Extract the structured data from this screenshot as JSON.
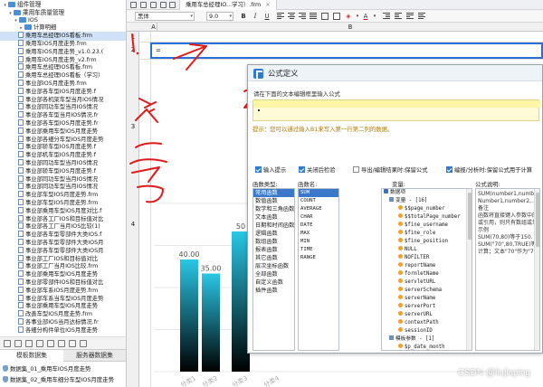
{
  "tree": {
    "items": [
      {
        "level": 0,
        "kind": "folder",
        "label": "组件管理",
        "expand": "▾"
      },
      {
        "level": 1,
        "kind": "folder",
        "label": "乘用车质量管理",
        "expand": "▾"
      },
      {
        "level": 2,
        "kind": "folder",
        "label": "IOS",
        "expand": "▾"
      },
      {
        "level": 3,
        "kind": "folder",
        "label": "计算明细",
        "expand": "▸"
      },
      {
        "level": 3,
        "kind": "file",
        "label": "乘用车总经理IOS看板.frm",
        "selected": true
      },
      {
        "level": 3,
        "kind": "file",
        "label": "乘用车IOS月度走势.frm"
      },
      {
        "level": 3,
        "kind": "file",
        "label": "乘用车IOS月度走势_v1.0.23.("
      },
      {
        "level": 3,
        "kind": "file",
        "label": "乘用车IOS月度走势_v2.frm"
      },
      {
        "level": 3,
        "kind": "file",
        "label": "乘用车总经理IOS看板.frm"
      },
      {
        "level": 3,
        "kind": "file",
        "label": "乘用车总经理IOS看板（学习）"
      },
      {
        "level": 3,
        "kind": "file",
        "label": "事业部IOS月度走势.frm"
      },
      {
        "level": 3,
        "kind": "file",
        "label": "事业部各车型IOS月度走势.f"
      },
      {
        "level": 3,
        "kind": "file",
        "label": "事业部各机架车型当月IOS情况"
      },
      {
        "level": 3,
        "kind": "file",
        "label": "事业部同功车型当月IOS情况"
      },
      {
        "level": 3,
        "kind": "file",
        "label": "事业部各车型当月IOS情况.fr"
      },
      {
        "level": 3,
        "kind": "file",
        "label": "事业部各车型IOS月度走势.fr"
      },
      {
        "level": 3,
        "kind": "file",
        "label": "事业部乘用车型IOS月度走势"
      },
      {
        "level": 3,
        "kind": "file",
        "label": "事业部各细分车型IOS月度走势"
      },
      {
        "level": 3,
        "kind": "file",
        "label": "事业部轿车型IOS月度走势.f"
      },
      {
        "level": 3,
        "kind": "file",
        "label": "事业部机车型IOS月度走势.f"
      },
      {
        "level": 3,
        "kind": "file",
        "label": "事业部同功车型当月IOS情况"
      },
      {
        "level": 3,
        "kind": "file",
        "label": "事业部轿车型IOS月度走势.f"
      },
      {
        "level": 3,
        "kind": "file",
        "label": "事业部同功车型当月IOS情况"
      },
      {
        "level": 3,
        "kind": "file",
        "label": "事业部同功车型当月IOS情况"
      },
      {
        "level": 3,
        "kind": "file",
        "label": "事业部车型IOS月度走势.frm"
      },
      {
        "level": 3,
        "kind": "file",
        "label": "事业部车型IOS月度走势.frm"
      },
      {
        "level": 3,
        "kind": "file",
        "label": "事业部乘用车型IOS月度对比.f"
      },
      {
        "level": 3,
        "kind": "file",
        "label": "事业部各工厂IOS和目标值对比"
      },
      {
        "level": 3,
        "kind": "file",
        "label": "事业部各工厂当月IOS比较(1)"
      },
      {
        "level": 3,
        "kind": "file",
        "label": "事业部各车型零部件大类IOS.f"
      },
      {
        "level": 3,
        "kind": "file",
        "label": "事业部各车型零部件大类IOS月"
      },
      {
        "level": 3,
        "kind": "file",
        "label": "事业部各车型零部件大类IOS月"
      },
      {
        "level": 3,
        "kind": "file",
        "label": "事业部工厂IOS和目标值对比"
      },
      {
        "level": 3,
        "kind": "file",
        "label": "事业部工厂当月IOS比较.frm"
      },
      {
        "level": 3,
        "kind": "file",
        "label": "事业部乘用车型IOS月度走势"
      },
      {
        "level": 3,
        "kind": "file",
        "label": "事业部零部件IOS和目标值对比"
      },
      {
        "level": 3,
        "kind": "file",
        "label": "事业部车系IOS月度走势.frm"
      },
      {
        "level": 3,
        "kind": "file",
        "label": "事业部车系当车型IOS月度走势"
      },
      {
        "level": 3,
        "kind": "file",
        "label": "事业部乘用车型IOS月度走势"
      },
      {
        "level": 3,
        "kind": "file",
        "label": "改善车型IOS月度走势.frm"
      },
      {
        "level": 3,
        "kind": "file",
        "label": "各事业部IOS当月达标情况.fr"
      },
      {
        "level": 3,
        "kind": "file",
        "label": "各细分构件单位IOS月度走势"
      }
    ]
  },
  "left_tabs": {
    "template": "模板数据集",
    "server": "服务器数据集"
  },
  "datasets": [
    {
      "label": "数据集_01_乘用车IOS月度走势"
    },
    {
      "label": "数据集_02_乘用车细分车型IOS月度走势"
    }
  ],
  "toolbar": {
    "doc_tab": "乘用车总经理IO...学习）.frm",
    "close": "×",
    "font_name": "黑体",
    "font_size": "9.0",
    "bold": "B",
    "italic": "I",
    "underline": "U",
    "dd": "▾"
  },
  "grid": {
    "col_a": "A",
    "col_b": "B",
    "rows": [
      {
        "label": "1"
      },
      {
        "label": "2"
      },
      {
        "label": "3"
      },
      {
        "label": "4"
      }
    ],
    "cell_b2": "="
  },
  "chart_data": {
    "type": "bar",
    "categories": [
      "分类1",
      "分类2",
      "分类3",
      "分类4"
    ],
    "series": [
      {
        "values": [
          40,
          35,
          50,
          0
        ]
      }
    ],
    "value_labels": [
      "40.00",
      "35.00",
      "50",
      ""
    ],
    "ylim": [
      0,
      60
    ],
    "colors": {
      "bar_top": "#29c7e6",
      "bar_bottom": "#000000"
    }
  },
  "ink": {
    "text": "第二号",
    "left_mark": "1.",
    "right_mark": "2."
  },
  "dialog": {
    "title": "公式定义",
    "prompt": "请在下面的文本编辑框里输入公式",
    "tip": "提示：您可以通过输入B1来写入第一行第二列的数据。",
    "options": {
      "input_hint": "输入提示",
      "auto_close": "关闭后检验",
      "export_keep": "导出/编辑结果时:保留公式",
      "sort_analysis": "编报/分析时:保留公式用于计算"
    },
    "columns": {
      "category": "函数类型:",
      "name": "函数名:",
      "variable": "变量:",
      "description": "公式说明:"
    },
    "categories": [
      "常用函数",
      "数值函数",
      "数学和三角函数",
      "文本函数",
      "日期和时间函数",
      "逻辑函数",
      "数组函数",
      "报表函数",
      "其它函数",
      "层次坐标函数",
      "全部函数",
      "自定义函数",
      "插件函数"
    ],
    "functions": [
      "SUM",
      "COUNT",
      "AVERAGE",
      "CHAR",
      "DATE",
      "MAX",
      "MIN",
      "TIME",
      "RANGE"
    ],
    "variables": [
      {
        "level": 0,
        "kind": "db",
        "label": "数据项"
      },
      {
        "level": 1,
        "kind": "v",
        "label": "变量 - [16]"
      },
      {
        "level": 2,
        "kind": "p",
        "label": "$$page_number"
      },
      {
        "level": 2,
        "kind": "p",
        "label": "$$totalPage_number"
      },
      {
        "level": 2,
        "kind": "p",
        "label": "$fine_username"
      },
      {
        "level": 2,
        "kind": "p",
        "label": "$fine_role"
      },
      {
        "level": 2,
        "kind": "p",
        "label": "$fine_position"
      },
      {
        "level": 2,
        "kind": "p",
        "label": "NULL"
      },
      {
        "level": 2,
        "kind": "p",
        "label": "NOFILTER"
      },
      {
        "level": 2,
        "kind": "p",
        "label": "reportName"
      },
      {
        "level": 2,
        "kind": "p",
        "label": "formletName"
      },
      {
        "level": 2,
        "kind": "p",
        "label": "servletURL"
      },
      {
        "level": 2,
        "kind": "p",
        "label": "serverSchema"
      },
      {
        "level": 2,
        "kind": "p",
        "label": "serverName"
      },
      {
        "level": 2,
        "kind": "p",
        "label": "serverPort"
      },
      {
        "level": 2,
        "kind": "p",
        "label": "serverURL"
      },
      {
        "level": 2,
        "kind": "p",
        "label": "contextPath"
      },
      {
        "level": 2,
        "kind": "p",
        "label": "sessionID"
      },
      {
        "level": 1,
        "kind": "v",
        "label": "模板参数 - [1]"
      },
      {
        "level": 2,
        "kind": "p",
        "label": "$p_date_month"
      }
    ],
    "description_lines": [
      "SUM(number1,number2,…",
      "Number1,number2,…:1到3",
      "备注",
      "函数将直接键入参数中的",
      "或引用，则只有数组或单",
      "示例",
      "SUM(70,80)等于150.",
      "SUM(\"70\",80,TRUE)等于1",
      "计算；文本\"70\"作为\"70\""
    ]
  },
  "watermark": "CSDN @liujiaping"
}
